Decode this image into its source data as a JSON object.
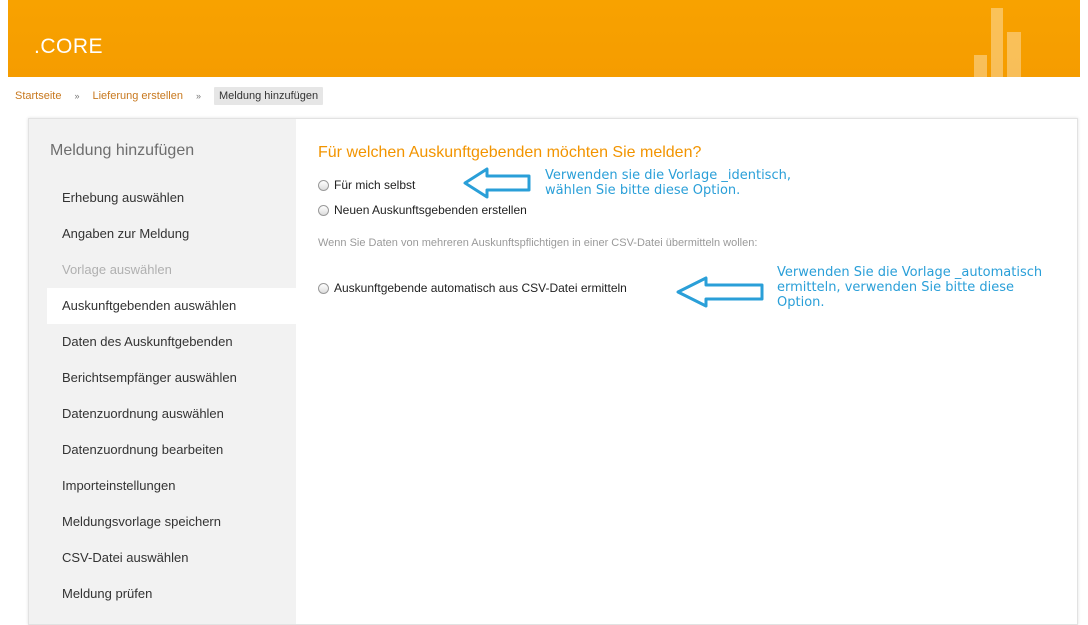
{
  "header": {
    "logo": ".CORE"
  },
  "breadcrumb": {
    "items": [
      "Startseite",
      "Lieferung erstellen"
    ],
    "separator": "»",
    "current": "Meldung hinzufügen"
  },
  "sidebar": {
    "title": "Meldung hinzufügen",
    "items": [
      {
        "label": "Erhebung auswählen",
        "state": "normal"
      },
      {
        "label": "Angaben zur Meldung",
        "state": "normal"
      },
      {
        "label": "Vorlage auswählen",
        "state": "disabled"
      },
      {
        "label": "Auskunftgebenden auswählen",
        "state": "active"
      },
      {
        "label": "Daten des Auskunftgebenden",
        "state": "normal"
      },
      {
        "label": "Berichtsempfänger auswählen",
        "state": "normal"
      },
      {
        "label": "Datenzuordnung auswählen",
        "state": "normal"
      },
      {
        "label": "Datenzuordnung bearbeiten",
        "state": "normal"
      },
      {
        "label": "Importeinstellungen",
        "state": "normal"
      },
      {
        "label": "Meldungsvorlage speichern",
        "state": "normal"
      },
      {
        "label": "CSV-Datei auswählen",
        "state": "normal"
      },
      {
        "label": "Meldung prüfen",
        "state": "normal"
      }
    ]
  },
  "main": {
    "question": "Für welchen Auskunftgebenden möchten Sie melden?",
    "options": [
      {
        "label": "Für mich selbst"
      },
      {
        "label": "Neuen Auskunftsgebenden erstellen"
      }
    ],
    "hint": "Wenn Sie Daten von mehreren Auskunftspflichtigen in einer CSV-Datei übermitteln wollen:",
    "csv_option": {
      "label": "Auskunftgebende automatisch aus CSV-Datei ermitteln"
    }
  },
  "annotations": {
    "note1": [
      "Verwenden sie die Vorlage _identisch,",
      "wählen Sie bitte diese Option."
    ],
    "note2": [
      "Verwenden Sie die Vorlage _automatisch",
      "ermitteln, verwenden Sie bitte diese",
      "Option."
    ],
    "color": "#2a9fd8"
  },
  "colors": {
    "brand": "#f59c00",
    "question": "#f29400",
    "breadcrumb_link": "#c8781e"
  }
}
